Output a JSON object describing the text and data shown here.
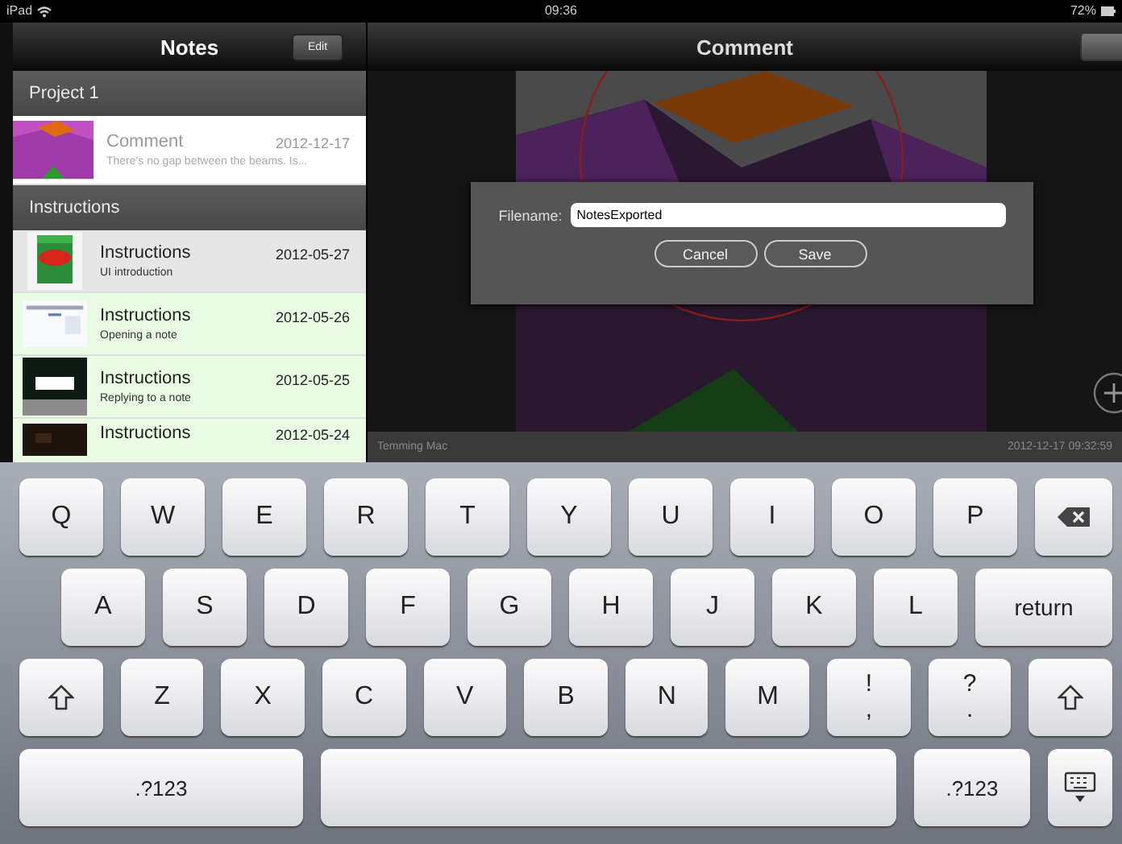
{
  "status_bar": {
    "device": "iPad",
    "time": "09:36",
    "battery": "72%"
  },
  "sidebar": {
    "title": "Notes",
    "edit_button": "Edit",
    "sections": [
      {
        "title": "Project 1",
        "items": [
          {
            "title": "Comment",
            "date": "2012-12-17",
            "subtitle": "There's no gap between the beams. Is...",
            "kind": "model",
            "selected": true
          }
        ]
      },
      {
        "title": "Instructions",
        "items": [
          {
            "title": "Instructions",
            "date": "2012-05-27",
            "subtitle": "UI introduction",
            "kind": "map",
            "selected": false,
            "read": true
          },
          {
            "title": "Instructions",
            "date": "2012-05-26",
            "subtitle": "Opening a note",
            "kind": "screen",
            "selected": false,
            "read": false
          },
          {
            "title": "Instructions",
            "date": "2012-05-25",
            "subtitle": "Replying to a note",
            "kind": "dialog",
            "selected": false,
            "read": false
          },
          {
            "title": "Instructions",
            "date": "2012-05-24",
            "kind": "dark",
            "selected": false,
            "read": false
          }
        ]
      }
    ]
  },
  "detail": {
    "title": "Comment",
    "author": "Temming Mac",
    "timestamp": "2012-12-17 09:32:59"
  },
  "dialog": {
    "label": "Filename:",
    "value": "NotesExported",
    "buttons": [
      "Cancel",
      "Save"
    ]
  },
  "keyboard": {
    "rows": [
      {
        "keys": [
          {
            "kind": "letter",
            "label": "Q"
          },
          {
            "kind": "letter",
            "label": "W"
          },
          {
            "kind": "letter",
            "label": "E"
          },
          {
            "kind": "letter",
            "label": "R"
          },
          {
            "kind": "letter",
            "label": "T"
          },
          {
            "kind": "letter",
            "label": "Y"
          },
          {
            "kind": "letter",
            "label": "U"
          },
          {
            "kind": "letter",
            "label": "I"
          },
          {
            "kind": "letter",
            "label": "O"
          },
          {
            "kind": "letter",
            "label": "P"
          },
          {
            "kind": "backspace"
          }
        ]
      },
      {
        "keys": [
          {
            "kind": "letter",
            "label": "A"
          },
          {
            "kind": "letter",
            "label": "S"
          },
          {
            "kind": "letter",
            "label": "D"
          },
          {
            "kind": "letter",
            "label": "F"
          },
          {
            "kind": "letter",
            "label": "G"
          },
          {
            "kind": "letter",
            "label": "H"
          },
          {
            "kind": "letter",
            "label": "J"
          },
          {
            "kind": "letter",
            "label": "K"
          },
          {
            "kind": "letter",
            "label": "L"
          },
          {
            "kind": "return",
            "label": "return"
          }
        ]
      },
      {
        "keys": [
          {
            "kind": "shift"
          },
          {
            "kind": "letter",
            "label": "Z"
          },
          {
            "kind": "letter",
            "label": "X"
          },
          {
            "kind": "letter",
            "label": "C"
          },
          {
            "kind": "letter",
            "label": "V"
          },
          {
            "kind": "letter",
            "label": "B"
          },
          {
            "kind": "letter",
            "label": "N"
          },
          {
            "kind": "letter",
            "label": "M"
          },
          {
            "kind": "dual",
            "label": "!",
            "sub": ","
          },
          {
            "kind": "dual",
            "label": "?",
            "sub": "."
          },
          {
            "kind": "shift"
          }
        ]
      },
      {
        "keys": [
          {
            "kind": "numbers",
            "label": ".?123"
          },
          {
            "kind": "space"
          },
          {
            "kind": "numbers-short",
            "label": ".?123"
          },
          {
            "kind": "hide"
          }
        ]
      }
    ]
  }
}
